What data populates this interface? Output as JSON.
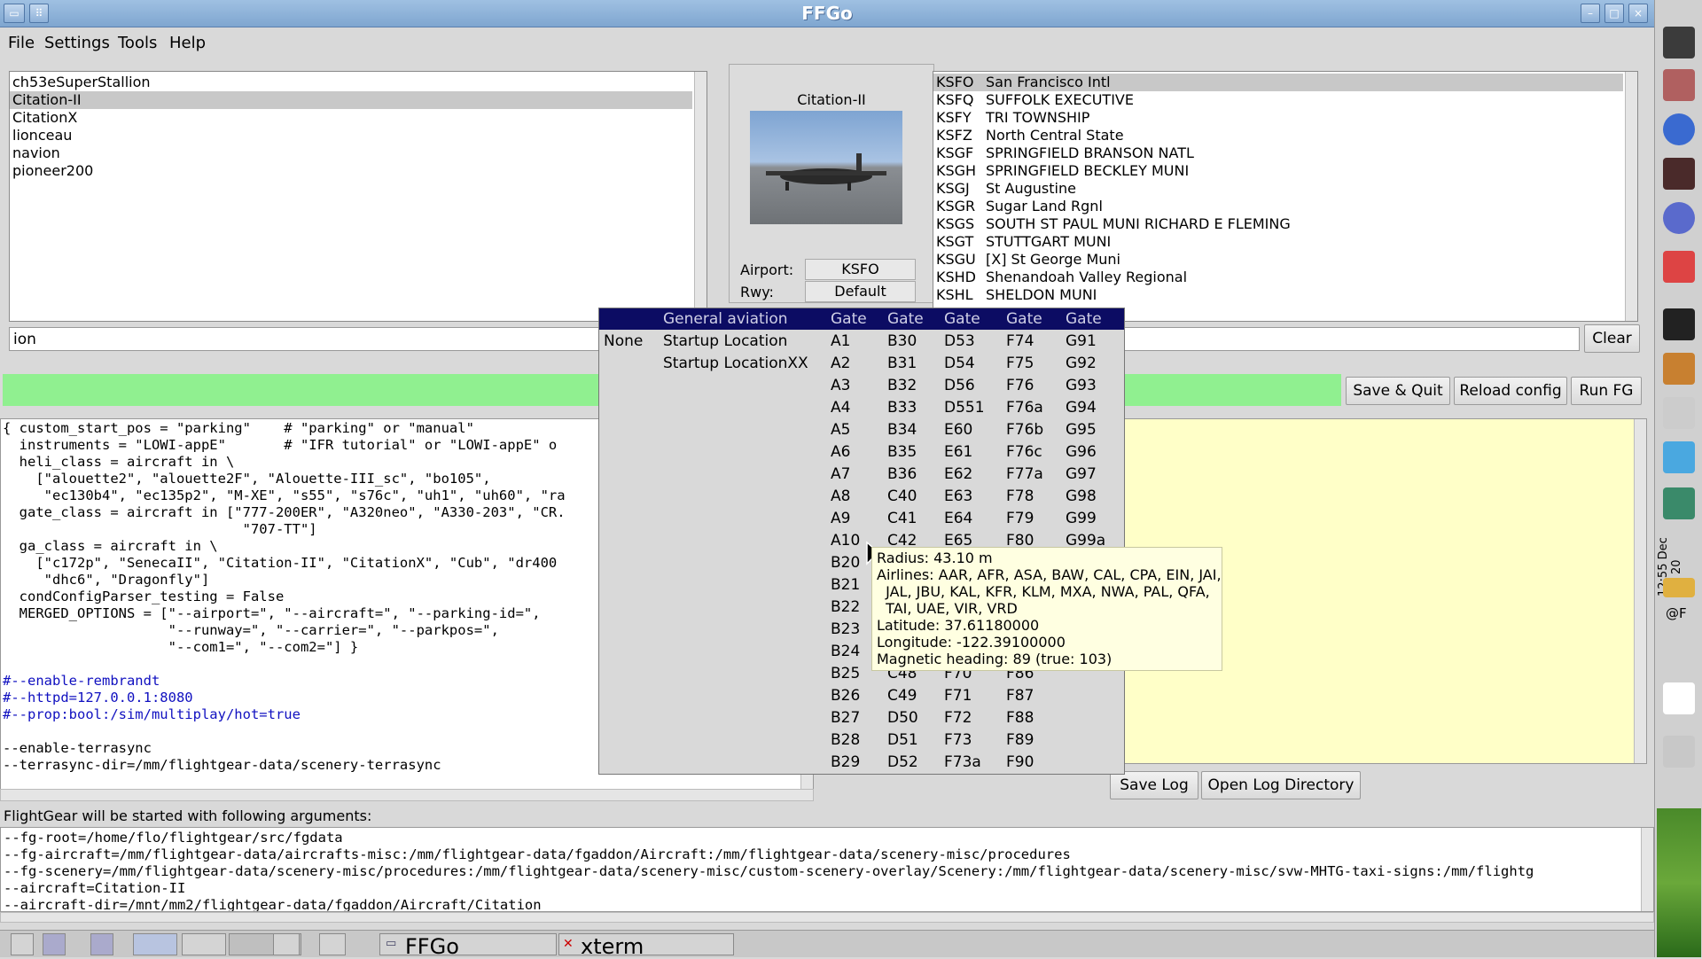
{
  "window": {
    "title": "FFGo"
  },
  "menu": [
    "File",
    "Settings",
    "Tools",
    "Help"
  ],
  "aircraft_list": [
    "ch53eSuperStallion",
    "Citation-II",
    "CitationX",
    "lionceau",
    "navion",
    "pioneer200"
  ],
  "aircraft_selected_index": 1,
  "preview": {
    "aircraft_name": "Citation-II",
    "airport_label": "Airport:",
    "airport_value": "KSFO",
    "rwy_label": "Rwy:",
    "rwy_value": "Default"
  },
  "airport_list": [
    [
      "KSFO",
      "San Francisco Intl"
    ],
    [
      "KSFQ",
      "SUFFOLK EXECUTIVE"
    ],
    [
      "KSFY",
      "TRI TOWNSHIP"
    ],
    [
      "KSFZ",
      "North Central State"
    ],
    [
      "KSGF",
      "SPRINGFIELD BRANSON NATL"
    ],
    [
      "KSGH",
      "SPRINGFIELD BECKLEY MUNI"
    ],
    [
      "KSGJ",
      "St Augustine"
    ],
    [
      "KSGR",
      "Sugar Land Rgnl"
    ],
    [
      "KSGS",
      "SOUTH ST PAUL MUNI RICHARD E FLEMING"
    ],
    [
      "KSGT",
      "STUTTGART MUNI"
    ],
    [
      "KSGU",
      "[X] St George Muni"
    ],
    [
      "KSHD",
      "Shenandoah Valley Regional"
    ],
    [
      "KSHL",
      "SHELDON MUNI"
    ]
  ],
  "search": {
    "value": "ion",
    "clear_label": "Clear"
  },
  "buttons": {
    "save_quit": "Save & Quit",
    "reload": "Reload config",
    "run": "Run FG",
    "save_log": "Save Log",
    "open_log": "Open Log Directory"
  },
  "config_text": [
    {
      "t": "{ custom_start_pos = \"parking\"    # \"parking\" or \"manual\"",
      "c": "black"
    },
    {
      "t": "  instruments = \"LOWI-appE\"       # \"IFR tutorial\" or \"LOWI-appE\" o",
      "c": "black"
    },
    {
      "t": "  heli_class = aircraft in \\",
      "c": "black"
    },
    {
      "t": "    [\"alouette2\", \"alouette2F\", \"Alouette-III_sc\", \"bo105\",",
      "c": "black"
    },
    {
      "t": "     \"ec130b4\", \"ec135p2\", \"M-XE\", \"s55\", \"s76c\", \"uh1\", \"uh60\", \"ra",
      "c": "black"
    },
    {
      "t": "  gate_class = aircraft in [\"777-200ER\", \"A320neo\", \"A330-203\", \"CR.",
      "c": "black"
    },
    {
      "t": "                             \"707-TT\"]",
      "c": "black"
    },
    {
      "t": "  ga_class = aircraft in \\",
      "c": "black"
    },
    {
      "t": "    [\"c172p\", \"SenecaII\", \"Citation-II\", \"CitationX\", \"Cub\", \"dr400",
      "c": "black"
    },
    {
      "t": "     \"dhc6\", \"Dragonfly\"]",
      "c": "black"
    },
    {
      "t": "  condConfigParser_testing = False",
      "c": "black"
    },
    {
      "t": "  MERGED_OPTIONS = [\"--airport=\", \"--aircraft=\", \"--parking-id=\",",
      "c": "black"
    },
    {
      "t": "                    \"--runway=\", \"--carrier=\", \"--parkpos=\",",
      "c": "black"
    },
    {
      "t": "                    \"--com1=\", \"--com2=\"] }",
      "c": "black"
    },
    {
      "t": "",
      "c": "black"
    },
    {
      "t": "#--enable-rembrandt",
      "c": "blue"
    },
    {
      "t": "#--httpd=127.0.0.1:8080",
      "c": "blue"
    },
    {
      "t": "#--prop:bool:/sim/multiplay/hot=true",
      "c": "blue"
    },
    {
      "t": "",
      "c": "black"
    },
    {
      "t": "--enable-terrasync",
      "c": "black"
    },
    {
      "t": "--terrasync-dir=/mm/flightgear-data/scenery-terrasync",
      "c": "black"
    }
  ],
  "args_label": "FlightGear will be started with following arguments:",
  "args_text": [
    "--fg-root=/home/flo/flightgear/src/fgdata",
    "--fg-aircraft=/mm/flightgear-data/aircrafts-misc:/mm/flightgear-data/fgaddon/Aircraft:/mm/flightgear-data/scenery-misc/procedures",
    "--fg-scenery=/mm/flightgear-data/scenery-misc/procedures:/mm/flightgear-data/scenery-misc/custom-scenery-overlay/Scenery:/mm/flightgear-data/scenery-misc/svw-MHTG-taxi-signs:/mm/flightg",
    "--aircraft=Citation-II",
    "--aircraft-dir=/mnt/mm2/flightgear-data/fgaddon/Aircraft/Citation"
  ],
  "parking_popup": {
    "headers": [
      "General aviation",
      "Gate",
      "Gate",
      "Gate",
      "Gate",
      "Gate"
    ],
    "none_label": "None",
    "ga_items": [
      "Startup Location",
      "Startup LocationXX"
    ],
    "columns": [
      [
        "A1",
        "A2",
        "A3",
        "A4",
        "A5",
        "A6",
        "A7",
        "A8",
        "A9",
        "A10",
        "B20",
        "B21",
        "B22",
        "B23",
        "B24",
        "B25",
        "B26",
        "B27",
        "B28",
        "B29"
      ],
      [
        "B30",
        "B31",
        "B32",
        "B33",
        "B34",
        "B35",
        "B36",
        "C40",
        "C41",
        "C42",
        "",
        "",
        "",
        "",
        "",
        "C48",
        "C49",
        "D50",
        "D51",
        "D52"
      ],
      [
        "D53",
        "D54",
        "D56",
        "D551",
        "E60",
        "E61",
        "E62",
        "E63",
        "E64",
        "E65",
        "",
        "",
        "",
        "",
        "",
        "F70",
        "F71",
        "F72",
        "F73",
        "F73a"
      ],
      [
        "F74",
        "F75",
        "F76",
        "F76a",
        "F76b",
        "F76c",
        "F77a",
        "F78",
        "F79",
        "F80",
        "",
        "",
        "",
        "",
        "",
        "F86",
        "F87",
        "F88",
        "F89",
        "F90"
      ],
      [
        "G91",
        "G92",
        "G93",
        "G94",
        "G95",
        "G96",
        "G97",
        "G98",
        "G99",
        "G99a",
        "",
        "",
        "",
        "",
        "",
        "",
        "",
        "",
        "",
        ""
      ]
    ]
  },
  "tooltip": [
    "Radius: 43.10 m",
    "Airlines: AAR, AFR, ASA, BAW, CAL, CPA, EIN, JAI,",
    "  JAL, JBU, KAL, KFR, KLM, MXA, NWA, PAL, QFA,",
    "  TAI, UAE, VIR, VRD",
    "Latitude: 37.61180000",
    "Longitude: -122.39100000",
    "Magnetic heading: 89 (true: 103)"
  ],
  "taskbar": {
    "items": [
      "FFGo",
      "xterm"
    ]
  },
  "dock": {
    "time": "12:55",
    "date": "Dec 20",
    "at_label": "@F"
  },
  "colors": {
    "status_green": "#90f090",
    "log_bg": "#ffffc8",
    "popup_header": "#0c0c63",
    "config_blue": "#1010c0"
  }
}
